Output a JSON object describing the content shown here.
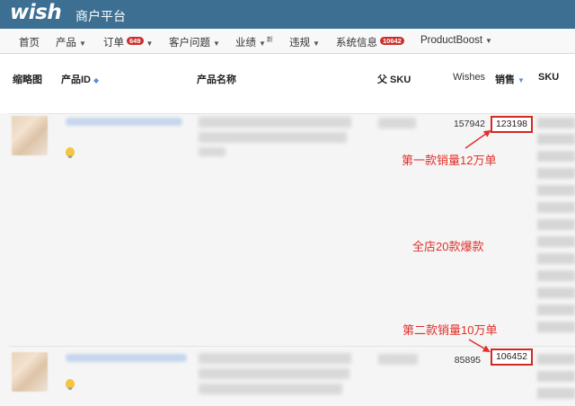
{
  "header": {
    "logo": "wish",
    "platform": "商户平台"
  },
  "nav": {
    "items": [
      {
        "label": "首页",
        "dropdown": false
      },
      {
        "label": "产品",
        "dropdown": true
      },
      {
        "label": "订单",
        "dropdown": true,
        "badge": "649"
      },
      {
        "label": "客户问题",
        "dropdown": true
      },
      {
        "label": "业绩",
        "dropdown": true,
        "mark": "新"
      },
      {
        "label": "违规",
        "dropdown": true
      },
      {
        "label": "系统信息",
        "badge": "10642",
        "dropdown": false
      },
      {
        "label": "ProductBoost",
        "dropdown": true
      }
    ]
  },
  "table": {
    "columns": {
      "thumbnail": "缩略图",
      "product_id": "产品ID",
      "product_name": "产品名称",
      "parent_sku": "父 SKU",
      "wishes": "Wishes",
      "sales": "销售",
      "sku": "SKU"
    },
    "rows": [
      {
        "wishes": "157942",
        "sales": "123198"
      },
      {
        "wishes": "85895",
        "sales": "106452"
      }
    ]
  },
  "annotations": {
    "first": "第一款销量12万单",
    "middle": "全店20款爆款",
    "second": "第二款销量10万单"
  },
  "colors": {
    "header_bg": "#3c6f92",
    "highlight": "#d12a20",
    "annotation": "#e0302a",
    "badge": "#c9302c"
  }
}
